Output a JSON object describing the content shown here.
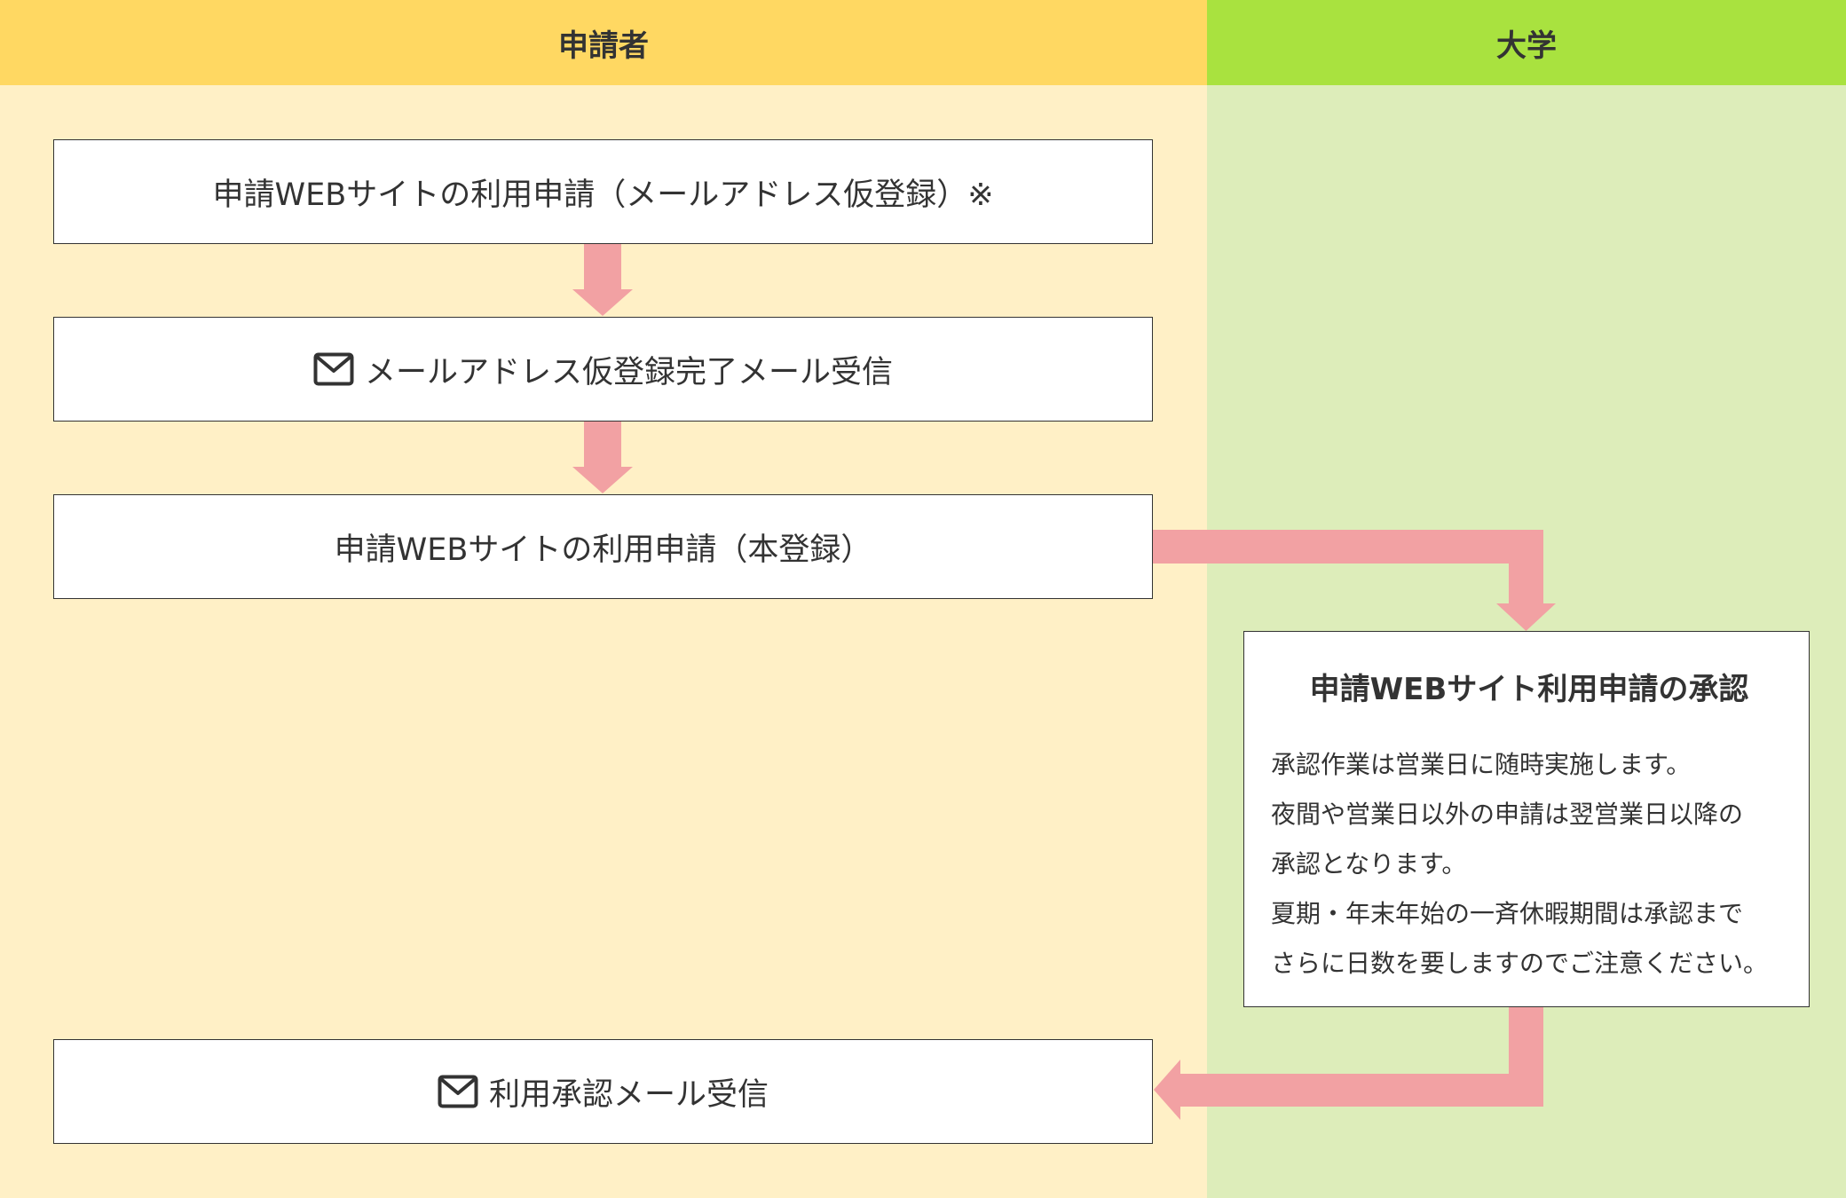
{
  "lanes": {
    "applicant": "申請者",
    "university": "大学"
  },
  "steps": {
    "apply_provisional": "申請WEBサイトの利用申請（メールアドレス仮登録）※",
    "provisional_mail": "メールアドレス仮登録完了メール受信",
    "apply_full": "申請WEBサイトの利用申請（本登録）",
    "approval": {
      "title": "申請WEBサイト利用申請の承認",
      "lines": [
        "承認作業は営業日に随時実施します。",
        "夜間や営業日以外の申請は翌営業日以降の",
        "承認となります。",
        "夏期・年末年始の一斉休暇期間は承認まで",
        "さらに日数を要しますのでご注意ください。"
      ]
    },
    "approval_mail": "利用承認メール受信"
  },
  "icons": {
    "provisional_mail": "mail-icon",
    "approval_mail": "mail-icon"
  },
  "colors": {
    "applicant_header": "#FFD862",
    "applicant_body": "#FFF0C6",
    "university_header": "#A9E23F",
    "university_body": "#DDEDBA",
    "arrow": "#F2A1A3"
  }
}
